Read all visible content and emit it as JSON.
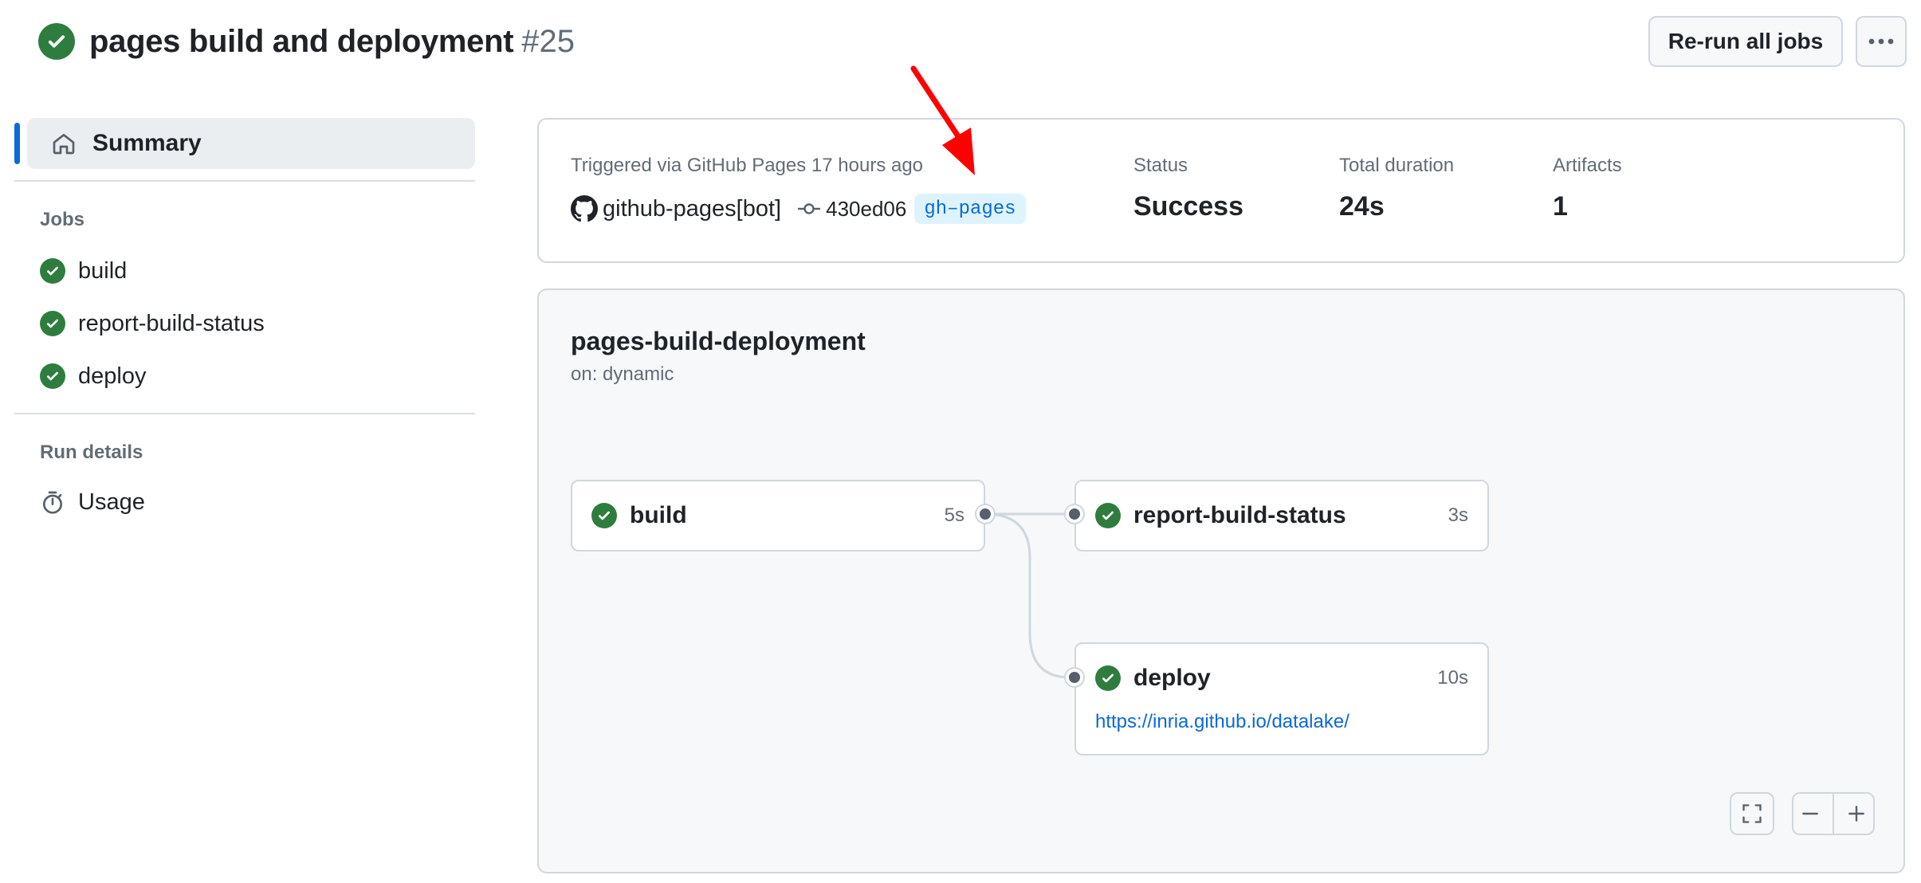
{
  "header": {
    "title": "pages build and deployment",
    "run_number": "#25",
    "rerun_label": "Re-run all jobs",
    "more_icon": "kebab-horizontal-icon"
  },
  "sidebar": {
    "summary_label": "Summary",
    "jobs_heading": "Jobs",
    "jobs": [
      {
        "label": "build",
        "status": "success"
      },
      {
        "label": "report-build-status",
        "status": "success"
      },
      {
        "label": "deploy",
        "status": "success"
      }
    ],
    "run_details_heading": "Run details",
    "usage_label": "Usage"
  },
  "summary": {
    "triggered": "Triggered via GitHub Pages 17 hours ago",
    "actor": "github-pages[bot]",
    "commit": "430ed06",
    "branch": "gh–pages",
    "status_label": "Status",
    "status_value": "Success",
    "duration_label": "Total duration",
    "duration_value": "24s",
    "artifacts_label": "Artifacts",
    "artifacts_value": "1"
  },
  "workflow": {
    "name": "pages-build-deployment",
    "trigger": "on: dynamic",
    "jobs": [
      {
        "name": "build",
        "duration": "5s"
      },
      {
        "name": "report-build-status",
        "duration": "3s"
      },
      {
        "name": "deploy",
        "duration": "10s",
        "link": "https://inria.github.io/datalake/"
      }
    ]
  },
  "colors": {
    "success": "#2e7d3f",
    "link": "#0969da",
    "annotation": "#ff0000"
  }
}
